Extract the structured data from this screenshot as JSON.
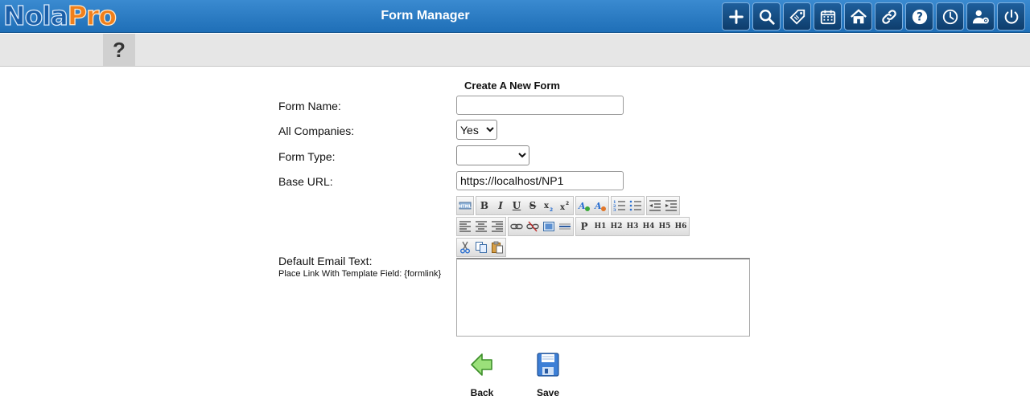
{
  "app": {
    "logo_part1": "Nola",
    "logo_part2": "Pro",
    "title": "Form Manager"
  },
  "toolbar_icons": [
    "plus-icon",
    "search-icon",
    "tag-icon",
    "calendar-icon",
    "home-icon",
    "link-icon",
    "help-icon",
    "clock-icon",
    "user-settings-icon",
    "power-icon"
  ],
  "subbar": {
    "help_label": "?"
  },
  "form": {
    "title": "Create A New Form",
    "form_name_label": "Form Name:",
    "form_name_value": "",
    "all_companies_label": "All Companies:",
    "all_companies_value": "Yes",
    "form_type_label": "Form Type:",
    "form_type_value": "",
    "base_url_label": "Base URL:",
    "base_url_value": "https://localhost/NP1",
    "email_text_label": "Default Email Text:",
    "email_text_hint": "Place Link With Template Field: {formlink}",
    "email_text_value": ""
  },
  "editor": {
    "headings": [
      "P",
      "H1",
      "H2",
      "H3",
      "H4",
      "H5",
      "H6"
    ]
  },
  "actions": {
    "back_label": "Back",
    "save_label": "Save"
  },
  "colors": {
    "topbar": "#2a7cc4",
    "logo_blue": "#1a5ea8",
    "logo_orange": "#f07f1a"
  }
}
